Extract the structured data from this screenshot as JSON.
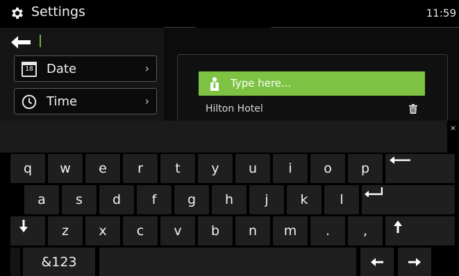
{
  "topbar": {
    "title": "Settings",
    "clock": "11:59",
    "icon": "gear-icon"
  },
  "left_menu": {
    "items": [
      {
        "label": "Date",
        "icon": "calendar-icon",
        "icon_text": "18"
      },
      {
        "label": "Time",
        "icon": "clock-icon"
      }
    ]
  },
  "search": {
    "placeholder": "Type here...",
    "icon": "person-icon"
  },
  "results": [
    {
      "label": "Hilton Hotel"
    }
  ],
  "keyboard": {
    "close": "×",
    "row1": [
      "q",
      "w",
      "e",
      "r",
      "t",
      "y",
      "u",
      "i",
      "o",
      "p"
    ],
    "row2": [
      "a",
      "s",
      "d",
      "f",
      "g",
      "h",
      "j",
      "k",
      "l"
    ],
    "row3": [
      "z",
      "x",
      "c",
      "v",
      "b",
      "n",
      "m",
      ".",
      ","
    ],
    "mode_label": "&123"
  },
  "colors": {
    "accent": "#7dc242",
    "background": "#000000",
    "key": "#1f1f1f"
  }
}
